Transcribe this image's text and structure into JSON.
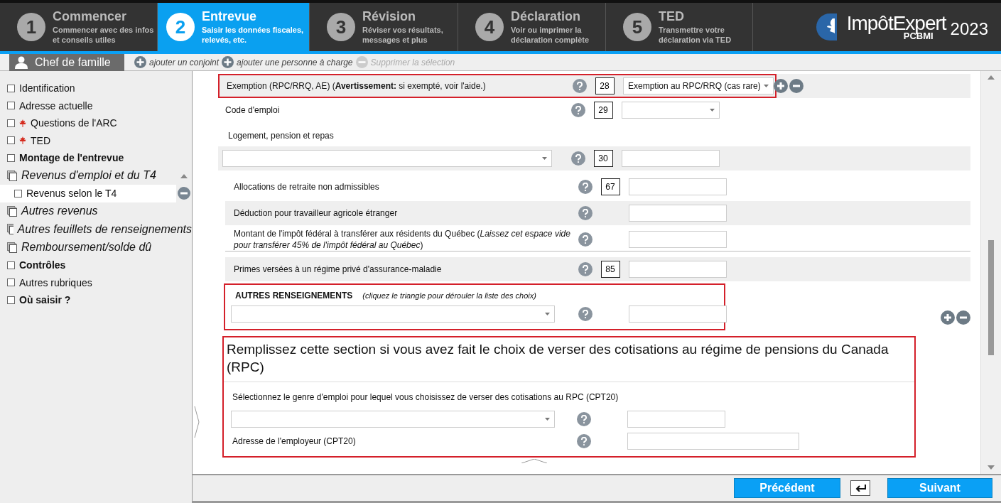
{
  "steps": [
    {
      "number": "1",
      "title": "Commencer",
      "subtitle": "Commencer avec des infos et conseils utiles",
      "selected": false
    },
    {
      "number": "2",
      "title": "Entrevue",
      "subtitle": "Saisir les données fiscales, relevés, etc.",
      "selected": true
    },
    {
      "number": "3",
      "title": "Révision",
      "subtitle": "Réviser vos résultats, messages et plus",
      "selected": false
    },
    {
      "number": "4",
      "title": "Déclaration",
      "subtitle": "Voir ou imprimer la déclaration complète",
      "selected": false
    },
    {
      "number": "5",
      "title": "TED",
      "subtitle": "Transmettre votre déclaration via TED",
      "selected": false
    }
  ],
  "logo": {
    "name": "ImpôtExpert",
    "sub": "PCBMI",
    "year": "2023"
  },
  "person_bar": {
    "person": "Chef de famille",
    "actions": [
      {
        "label": "ajouter un conjoint",
        "kind": "add",
        "disabled": false
      },
      {
        "label": "ajouter une personne à charge",
        "kind": "add",
        "disabled": false
      },
      {
        "label": "Supprimer la sélection",
        "kind": "remove",
        "disabled": true
      }
    ]
  },
  "sidebar": {
    "items": [
      {
        "label": "Identification",
        "kind": "page",
        "bold": false,
        "flag": false,
        "selected": false
      },
      {
        "label": "Adresse actuelle",
        "kind": "page",
        "bold": false,
        "flag": false,
        "selected": false
      },
      {
        "label": "Questions de l'ARC",
        "kind": "page",
        "bold": false,
        "flag": true,
        "selected": false
      },
      {
        "label": "TED",
        "kind": "page",
        "bold": false,
        "flag": true,
        "selected": false
      },
      {
        "label": "Montage de l'entrevue",
        "kind": "page",
        "bold": true,
        "flag": false,
        "selected": false
      },
      {
        "label": "Revenus d'emploi et du T4",
        "kind": "group",
        "expanded": true,
        "children": [
          {
            "label": "Revenus selon le T4",
            "kind": "page",
            "bold": false,
            "flag": false,
            "selected": true
          }
        ]
      },
      {
        "label": "Autres revenus",
        "kind": "group",
        "expanded": false
      },
      {
        "label": "Autres feuillets de renseignements",
        "kind": "group",
        "expanded": false
      },
      {
        "label": "Remboursement/solde dû",
        "kind": "group",
        "expanded": false
      },
      {
        "label": "Contrôles",
        "kind": "page",
        "bold": true,
        "flag": false,
        "selected": false
      },
      {
        "label": "Autres rubriques",
        "kind": "page",
        "bold": false,
        "flag": false,
        "selected": false
      },
      {
        "label": "Où saisir ?",
        "kind": "page",
        "bold": true,
        "flag": false,
        "selected": false
      }
    ]
  },
  "form": {
    "rows": [
      {
        "kind": "field",
        "label": "Exemption (RPC/RRQ, AE) (**Avertissement:** si exempté, voir l'aide.)",
        "code": "28",
        "control": {
          "kind": "select",
          "value": "Exemption au RPC/RRQ (cas rare)"
        },
        "shaded": true,
        "highlighted": true,
        "add_remove": true
      },
      {
        "kind": "field",
        "label": "Code d'emploi",
        "code": "29",
        "control": {
          "kind": "select"
        },
        "shaded": false,
        "highlighted": false
      },
      {
        "kind": "heading",
        "label": "Logement, pension et repas"
      },
      {
        "kind": "select_field",
        "code": "30",
        "control": {
          "kind": "input"
        },
        "shaded": true,
        "highlighted": false
      }
    ],
    "subgroup": [
      {
        "kind": "field",
        "label": "Allocations de retraite non admissibles",
        "code": "67",
        "control": {
          "kind": "input"
        },
        "shaded": false,
        "highlighted": false
      },
      {
        "kind": "field",
        "label": "Déduction pour travailleur agricole étranger",
        "control": {
          "kind": "input"
        },
        "shaded": true,
        "highlighted": false
      },
      {
        "kind": "field",
        "label": "Montant de l'impôt fédéral à transférer aux résidents du Québec (*Laissez cet espace vide pour transférer 45% de l'impôt fédéral au Québec*)",
        "control": {
          "kind": "input"
        },
        "shaded": false,
        "highlighted": false,
        "rule_below": true
      },
      {
        "kind": "field",
        "label": "Primes versées à un régime privé d'assurance-maladie",
        "code": "85",
        "control": {
          "kind": "input"
        },
        "shaded": true,
        "highlighted": false
      }
    ],
    "other_info": {
      "title": "AUTRES RENSEIGNEMENTS",
      "hint": "(cliquez le triangle pour dérouler la liste des choix)",
      "highlighted": true,
      "add_remove": true
    },
    "rpc": {
      "heading": "Remplissez cette section si vous avez fait le choix de verser des cotisations au régime de pensions du Canada (RPC)",
      "prompt": "Sélectionnez le genre d'emploi pour lequel vous choisissez de verser des cotisations au RPC (CPT20)",
      "address_label": "Adresse de l'employeur (CPT20)",
      "highlighted": true
    }
  },
  "footer": {
    "previous": "Précédent",
    "next": "Suivant"
  }
}
